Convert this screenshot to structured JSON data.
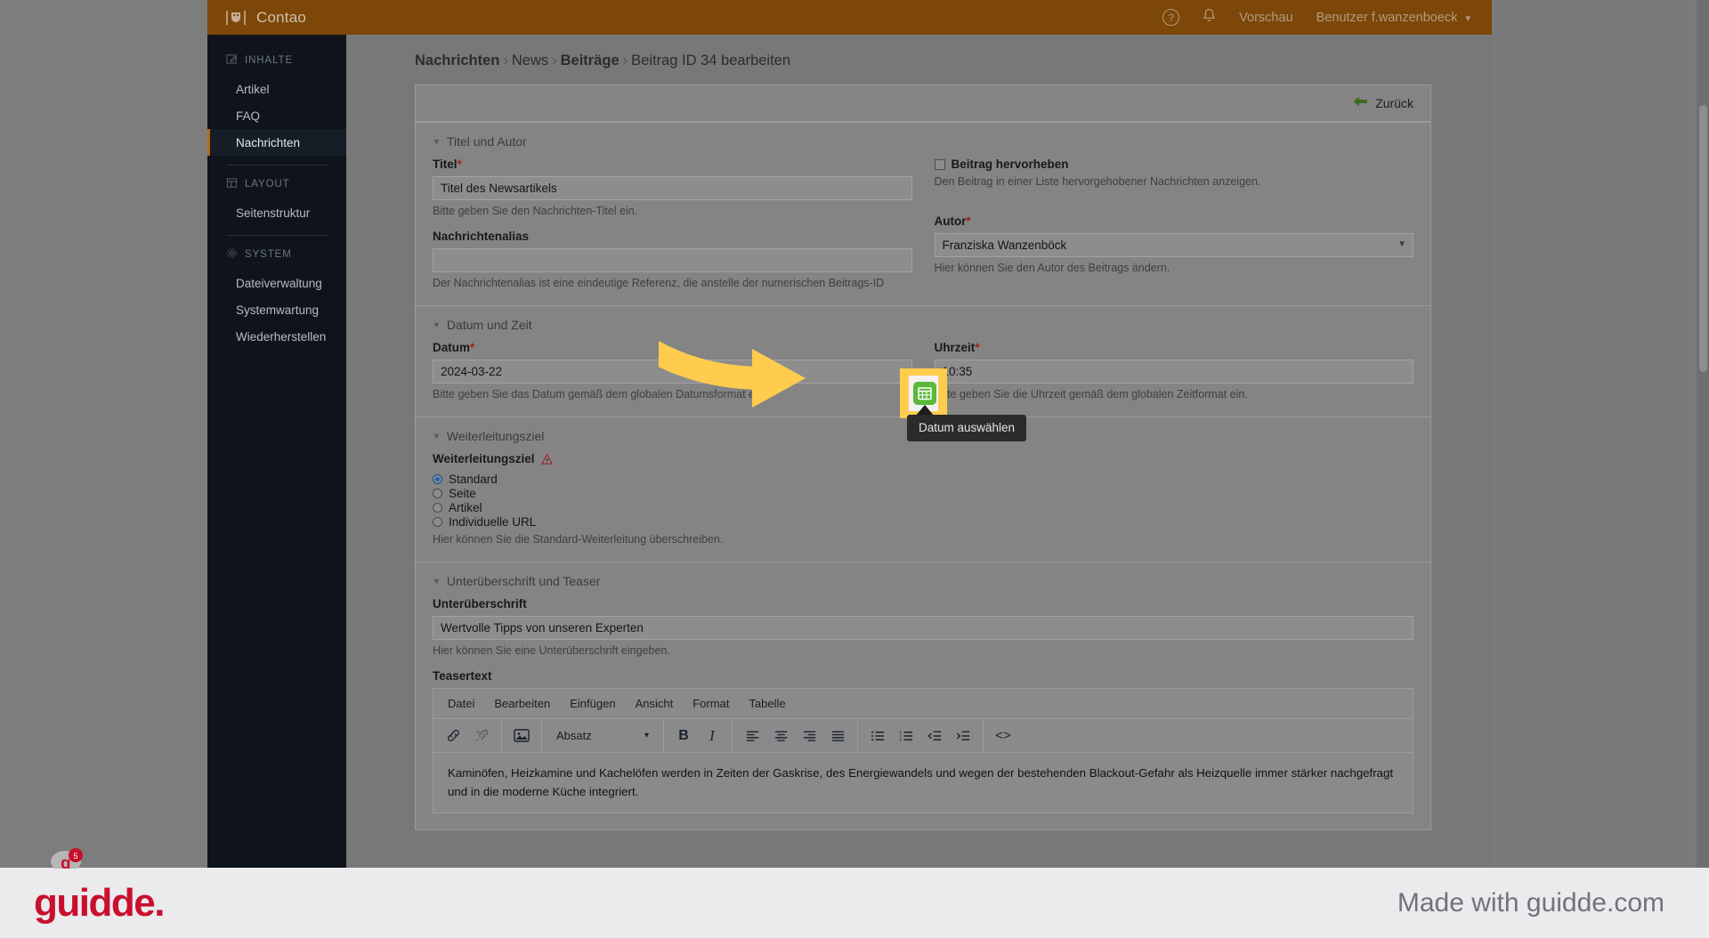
{
  "topbar": {
    "brand": "Contao",
    "help_icon": "help-circle-icon",
    "bell_icon": "bell-icon",
    "preview": "Vorschau",
    "user": "Benutzer f.wanzenboeck",
    "chevron": "⌄"
  },
  "sidebar": {
    "groups": [
      {
        "title": "INHALTE",
        "icon": "pencil-square-icon",
        "items": [
          {
            "label": "Artikel",
            "active": false
          },
          {
            "label": "FAQ",
            "active": false
          },
          {
            "label": "Nachrichten",
            "active": true
          }
        ]
      },
      {
        "title": "LAYOUT",
        "icon": "layout-icon",
        "items": [
          {
            "label": "Seitenstruktur",
            "active": false
          }
        ]
      },
      {
        "title": "SYSTEM",
        "icon": "gear-icon",
        "items": [
          {
            "label": "Dateiverwaltung",
            "active": false
          },
          {
            "label": "Systemwartung",
            "active": false
          },
          {
            "label": "Wiederherstellen",
            "active": false
          }
        ]
      }
    ]
  },
  "breadcrumb": {
    "part1": "Nachrichten",
    "part2": "News",
    "part3": "Beiträge",
    "part4": "Beitrag ID 34 bearbeiten",
    "separator": "›"
  },
  "panel": {
    "back_label": "Zurück",
    "back_icon": "arrow-left-icon"
  },
  "sections": {
    "titel_autor": {
      "legend": "Titel und Autor",
      "titel_label": "Titel",
      "titel_value": "Titel des Newsartikels",
      "titel_hint": "Bitte geben Sie den Nachrichten-Titel ein.",
      "alias_label": "Nachrichtenalias",
      "alias_value": "",
      "alias_hint": "Der Nachrichtenalias ist eine eindeutige Referenz, die anstelle der numerischen Beitrags-ID",
      "highlight_label": "Beitrag hervorheben",
      "highlight_hint": "Den Beitrag in einer Liste hervorgehobener Nachrichten anzeigen.",
      "highlight_checked": false,
      "autor_label": "Autor",
      "autor_value": "Franziska Wanzenböck",
      "autor_hint": "Hier können Sie den Autor des Beitrags ändern."
    },
    "datum_zeit": {
      "legend": "Datum und Zeit",
      "datum_label": "Datum",
      "datum_value": "2024-03-22",
      "datum_hint": "Bitte geben Sie das Datum gemäß dem globalen Datumsformat ein.",
      "uhrzeit_label": "Uhrzeit",
      "uhrzeit_value": "10:35",
      "uhrzeit_hint": "Bitte geben Sie die Uhrzeit gemäß dem globalen Zeitformat ein.",
      "calendar_icon": "calendar-picker-icon",
      "tooltip": "Datum auswählen"
    },
    "weiterleitungsziel": {
      "legend": "Weiterleitungsziel",
      "field_label": "Weiterleitungsziel",
      "warning_icon": "warning-triangle-icon",
      "options": [
        {
          "label": "Standard",
          "selected": true
        },
        {
          "label": "Seite",
          "selected": false
        },
        {
          "label": "Artikel",
          "selected": false
        },
        {
          "label": "Individuelle URL",
          "selected": false
        }
      ],
      "hint": "Hier können Sie die Standard-Weiterleitung überschreiben."
    },
    "unterueberschrift": {
      "legend": "Unterüberschrift und Teaser",
      "sub_label": "Unterüberschrift",
      "sub_value": "Wertvolle Tipps von unseren Experten",
      "sub_hint": "Hier können Sie eine Unterüberschrift eingeben.",
      "teaser_label": "Teasertext"
    }
  },
  "editor": {
    "menu": [
      "Datei",
      "Bearbeiten",
      "Einfügen",
      "Ansicht",
      "Format",
      "Tabelle"
    ],
    "format_select": "Absatz",
    "tools": [
      {
        "name": "link-icon",
        "glyph": "🔗",
        "disabled": false
      },
      {
        "name": "unlink-icon",
        "glyph": "🔗",
        "disabled": true
      },
      {
        "name": "image-icon",
        "glyph": "🖼",
        "disabled": false
      },
      {
        "name": "bold-icon",
        "glyph": "B",
        "disabled": false
      },
      {
        "name": "italic-icon",
        "glyph": "I",
        "disabled": false
      },
      {
        "name": "align-left-icon",
        "glyph": "≡",
        "disabled": false
      },
      {
        "name": "align-center-icon",
        "glyph": "≡",
        "disabled": false
      },
      {
        "name": "align-right-icon",
        "glyph": "≡",
        "disabled": false
      },
      {
        "name": "align-justify-icon",
        "glyph": "≡",
        "disabled": false
      },
      {
        "name": "bullet-list-icon",
        "glyph": "☰",
        "disabled": false
      },
      {
        "name": "numbered-list-icon",
        "glyph": "☰",
        "disabled": false
      },
      {
        "name": "outdent-icon",
        "glyph": "⇤",
        "disabled": false
      },
      {
        "name": "indent-icon",
        "glyph": "⇥",
        "disabled": false
      },
      {
        "name": "source-code-icon",
        "glyph": "<>",
        "disabled": false
      }
    ],
    "body": "Kaminöfen, Heizkamine und Kachelöfen werden in Zeiten der Gaskrise, des Energiewandels und wegen der bestehenden Blackout-Gefahr als Heizquelle immer stärker nachgefragt und in die moderne Küche integriert."
  },
  "guidde": {
    "logo": "guidde.",
    "made_with": "Made with guidde.com",
    "highlight_color": "#ffcc4d",
    "logo_color": "#c8102e"
  }
}
